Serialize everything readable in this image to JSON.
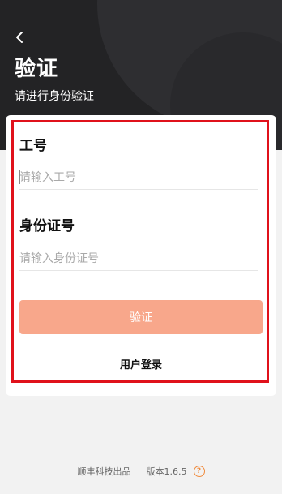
{
  "header": {
    "title": "验证",
    "subtitle": "请进行身份验证"
  },
  "form": {
    "employee_id": {
      "label": "工号",
      "placeholder": "请输入工号",
      "value": ""
    },
    "id_card": {
      "label": "身份证号",
      "placeholder": "请输入身份证号",
      "value": ""
    },
    "verify_button": "验证",
    "user_login_link": "用户登录"
  },
  "footer": {
    "brand": "顺丰科技出品",
    "version": "版本1.6.5",
    "help_icon": "question-circle-icon"
  },
  "colors": {
    "header_bg": "#232325",
    "accent": "#f8a78b",
    "highlight_border": "#e0111b"
  }
}
